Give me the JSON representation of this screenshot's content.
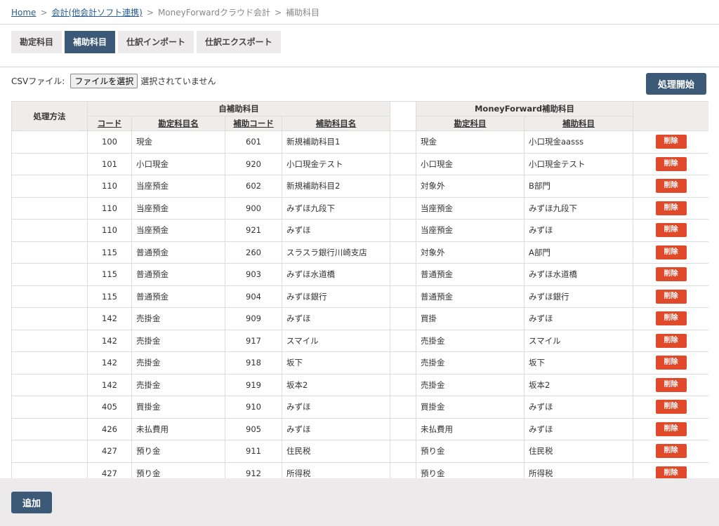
{
  "breadcrumb": {
    "home": "Home",
    "category": "会計(他会計ソフト連携)",
    "service": "MoneyForwardクラウド会計",
    "current": "補助科目"
  },
  "tabs": [
    {
      "label": "勘定科目",
      "active": false
    },
    {
      "label": "補助科目",
      "active": true
    },
    {
      "label": "仕訳インポート",
      "active": false
    },
    {
      "label": "仕訳エクスポート",
      "active": false
    }
  ],
  "csv": {
    "label": "CSVファイル:",
    "button": "ファイルを選択",
    "status": "選択されていません"
  },
  "process_button": "処理開始",
  "table": {
    "method_header": "処理方法",
    "own_group": "自補助科目",
    "mf_group": "MoneyForward補助科目",
    "columns": {
      "code": "コード",
      "account_name": "勘定科目名",
      "sub_code": "補助コード",
      "sub_name": "補助科目名",
      "mf_account": "勘定科目",
      "mf_sub": "補助科目"
    },
    "delete_label": "削除",
    "rows": [
      {
        "code": "100",
        "account": "現金",
        "sub_code": "601",
        "sub_name": "新規補助科目1",
        "mf_account": "現金",
        "mf_sub": "小口現金aasss"
      },
      {
        "code": "101",
        "account": "小口現金",
        "sub_code": "920",
        "sub_name": "小口現金テスト",
        "mf_account": "小口現金",
        "mf_sub": "小口現金テスト"
      },
      {
        "code": "110",
        "account": "当座預金",
        "sub_code": "602",
        "sub_name": "新規補助科目2",
        "mf_account": "対象外",
        "mf_sub": "B部門"
      },
      {
        "code": "110",
        "account": "当座預金",
        "sub_code": "900",
        "sub_name": "みずほ九段下",
        "mf_account": "当座預金",
        "mf_sub": "みずほ九段下"
      },
      {
        "code": "110",
        "account": "当座預金",
        "sub_code": "921",
        "sub_name": "みずほ",
        "mf_account": "当座預金",
        "mf_sub": "みずほ"
      },
      {
        "code": "115",
        "account": "普通預金",
        "sub_code": "260",
        "sub_name": "スラスラ銀行川崎支店",
        "mf_account": "対象外",
        "mf_sub": "A部門"
      },
      {
        "code": "115",
        "account": "普通預金",
        "sub_code": "903",
        "sub_name": "みずほ水道橋",
        "mf_account": "普通預金",
        "mf_sub": "みずほ水道橋"
      },
      {
        "code": "115",
        "account": "普通預金",
        "sub_code": "904",
        "sub_name": "みずほ銀行",
        "mf_account": "普通預金",
        "mf_sub": "みずほ銀行"
      },
      {
        "code": "142",
        "account": "売掛金",
        "sub_code": "909",
        "sub_name": "みずほ",
        "mf_account": "買掛",
        "mf_sub": "みずほ"
      },
      {
        "code": "142",
        "account": "売掛金",
        "sub_code": "917",
        "sub_name": "スマイル",
        "mf_account": "売掛金",
        "mf_sub": "スマイル"
      },
      {
        "code": "142",
        "account": "売掛金",
        "sub_code": "918",
        "sub_name": "坂下",
        "mf_account": "売掛金",
        "mf_sub": "坂下"
      },
      {
        "code": "142",
        "account": "売掛金",
        "sub_code": "919",
        "sub_name": "坂本2",
        "mf_account": "売掛金",
        "mf_sub": "坂本2"
      },
      {
        "code": "405",
        "account": "買掛金",
        "sub_code": "910",
        "sub_name": "みずほ",
        "mf_account": "買掛金",
        "mf_sub": "みずほ"
      },
      {
        "code": "426",
        "account": "未払費用",
        "sub_code": "905",
        "sub_name": "みずほ",
        "mf_account": "未払費用",
        "mf_sub": "みずほ"
      },
      {
        "code": "427",
        "account": "預り金",
        "sub_code": "911",
        "sub_name": "住民税",
        "mf_account": "預り金",
        "mf_sub": "住民税"
      },
      {
        "code": "427",
        "account": "預り金",
        "sub_code": "912",
        "sub_name": "所得税",
        "mf_account": "預り金",
        "mf_sub": "所得税"
      }
    ]
  },
  "add_button": "追加",
  "colors": {
    "primary": "#3c5a78",
    "danger": "#e04a2b",
    "tab_bg": "#eceaea",
    "header_bg": "#efecec"
  }
}
